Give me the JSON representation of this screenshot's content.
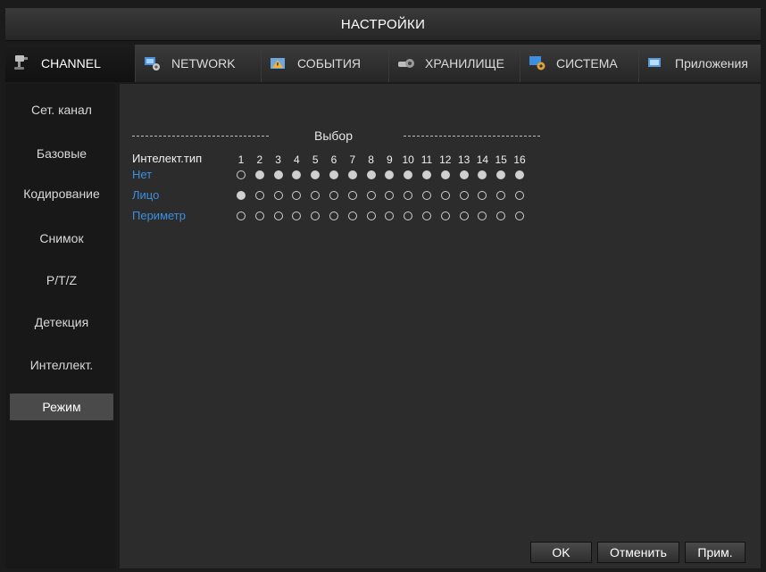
{
  "title": "НАСТРОЙКИ",
  "tabs": [
    {
      "label": "CHANNEL",
      "icon": "camera-icon",
      "active": true
    },
    {
      "label": "NETWORK",
      "icon": "network-icon",
      "active": false
    },
    {
      "label": "СОБЫТИЯ",
      "icon": "events-icon",
      "active": false
    },
    {
      "label": "ХРАНИЛИЩЕ",
      "icon": "storage-icon",
      "active": false
    },
    {
      "label": "СИСТЕМА",
      "icon": "system-icon",
      "active": false
    },
    {
      "label": "Приложения",
      "icon": "apps-icon",
      "active": false
    }
  ],
  "sidebar": {
    "items": [
      {
        "label": "Сет. канал"
      },
      {
        "label": "Базовые"
      },
      {
        "label": "Кодирование"
      },
      {
        "label": "Снимок"
      },
      {
        "label": "P/T/Z"
      },
      {
        "label": "Детекция"
      },
      {
        "label": "Интеллект."
      },
      {
        "label": "Режим"
      }
    ],
    "active_index": 7
  },
  "grid": {
    "header": "Выбор",
    "type_label": "Интелект.тип",
    "channels": [
      "1",
      "2",
      "3",
      "4",
      "5",
      "6",
      "7",
      "8",
      "9",
      "10",
      "11",
      "12",
      "13",
      "14",
      "15",
      "16"
    ],
    "rows": [
      {
        "label": "Нет",
        "selected": [
          false,
          true,
          true,
          true,
          true,
          true,
          true,
          true,
          true,
          true,
          true,
          true,
          true,
          true,
          true,
          true
        ]
      },
      {
        "label": "Лицо",
        "selected": [
          true,
          false,
          false,
          false,
          false,
          false,
          false,
          false,
          false,
          false,
          false,
          false,
          false,
          false,
          false,
          false
        ]
      },
      {
        "label": "Периметр",
        "selected": [
          false,
          false,
          false,
          false,
          false,
          false,
          false,
          false,
          false,
          false,
          false,
          false,
          false,
          false,
          false,
          false
        ]
      }
    ]
  },
  "buttons": {
    "ok": "OK",
    "cancel": "Отменить",
    "apply": "Прим."
  },
  "colors": {
    "accent_blue": "#3d8fe0",
    "panel_bg": "#2c2c2c",
    "active_side_bg": "#4a4a4a"
  }
}
